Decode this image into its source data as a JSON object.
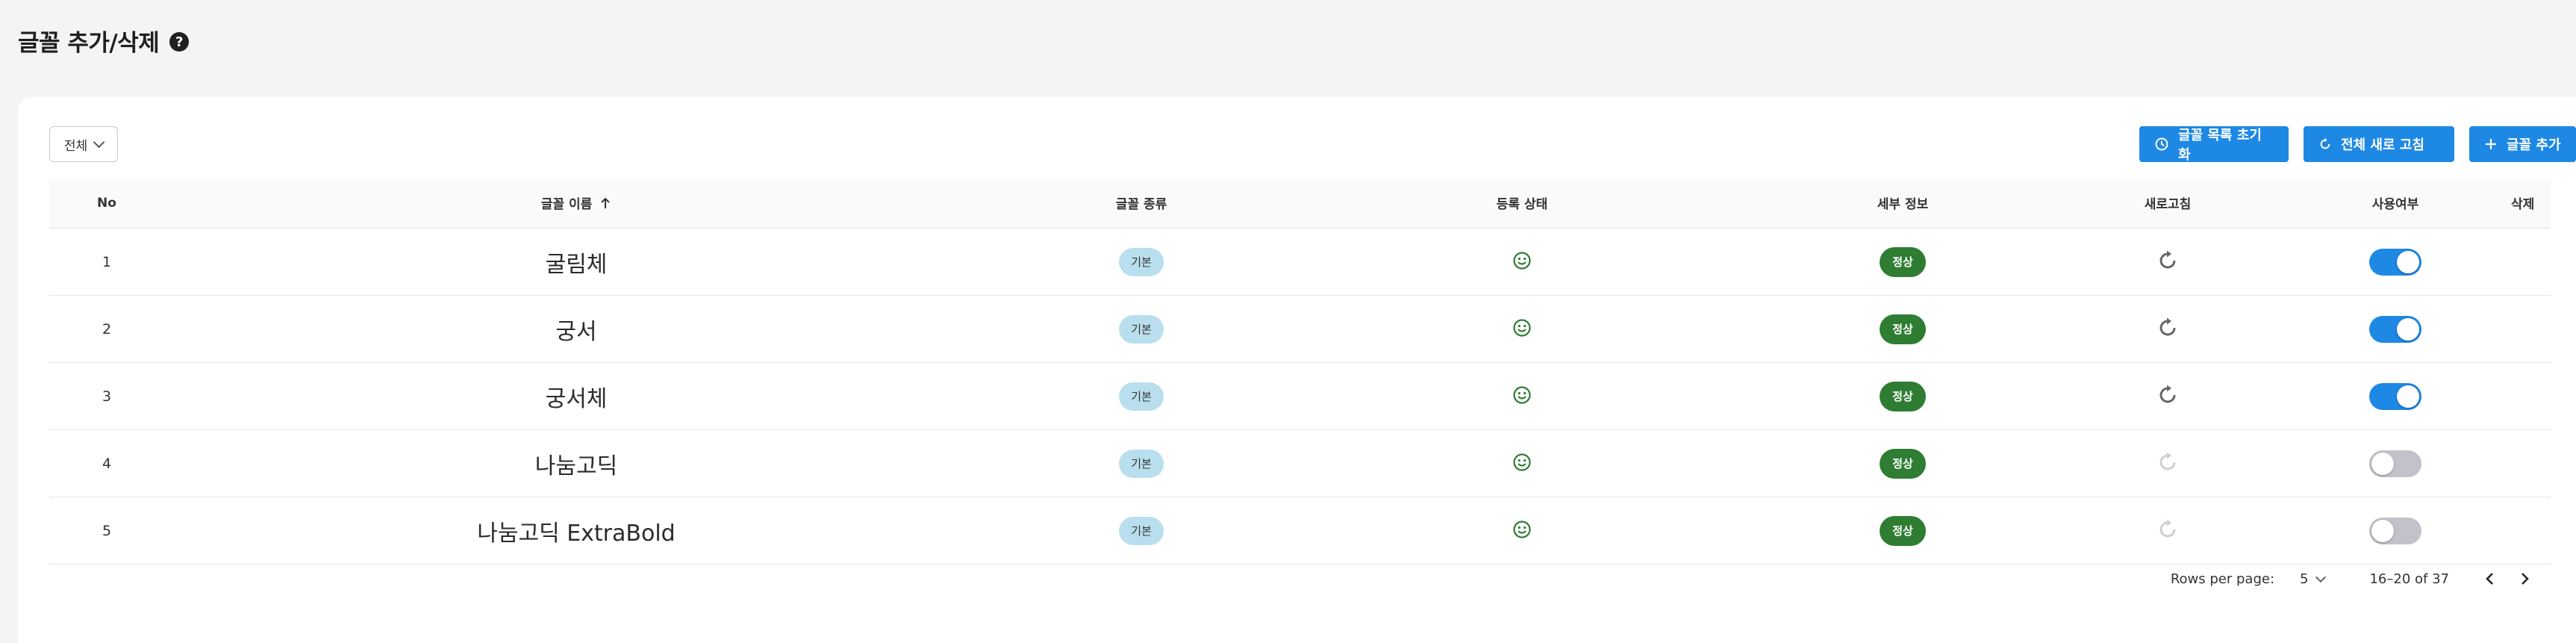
{
  "header": {
    "title": "글꼴 추가/삭제",
    "help_icon": "question-circle-icon"
  },
  "filter": {
    "selected": "전체"
  },
  "toolbar": {
    "reset_label": "글꼴 목록 초기화",
    "refresh_all_label": "전체 새로 고침",
    "add_label": "글꼴 추가"
  },
  "table": {
    "columns": {
      "no": "No",
      "name": "글꼴 이름",
      "type": "글꼴 종류",
      "reg": "등록 상태",
      "detail": "세부 정보",
      "refresh": "새로고침",
      "use": "사용여부",
      "delete": "삭제"
    },
    "rows": [
      {
        "no": "1",
        "name": "굴림체",
        "type": "기본",
        "detail": "정상",
        "refresh_enabled": true,
        "in_use": true
      },
      {
        "no": "2",
        "name": "궁서",
        "type": "기본",
        "detail": "정상",
        "refresh_enabled": true,
        "in_use": true
      },
      {
        "no": "3",
        "name": "궁서체",
        "type": "기본",
        "detail": "정상",
        "refresh_enabled": true,
        "in_use": true
      },
      {
        "no": "4",
        "name": "나눔고딕",
        "type": "기본",
        "detail": "정상",
        "refresh_enabled": false,
        "in_use": false
      },
      {
        "no": "5",
        "name": "나눔고딕 ExtraBold",
        "type": "기본",
        "detail": "정상",
        "refresh_enabled": false,
        "in_use": false
      }
    ]
  },
  "pagination": {
    "rows_per_page_label": "Rows per page:",
    "rows_per_page": "5",
    "range": "16–20 of 37"
  },
  "colors": {
    "primary": "#1e88e5",
    "success": "#2e7d32",
    "type_badge": "#b9dfee"
  }
}
